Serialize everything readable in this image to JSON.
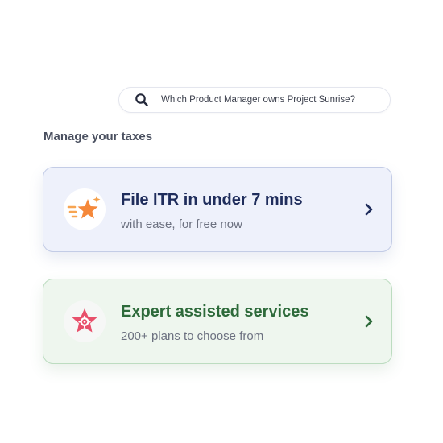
{
  "search": {
    "icon": "search-icon",
    "text": "Which Product Manager owns Project Sunrise?"
  },
  "section": {
    "title": "Manage your taxes"
  },
  "cards": [
    {
      "title": "File ITR in under 7 mins",
      "subtitle": "with ease, for free now",
      "icon": "sparkle-star-icon",
      "accent": "#f5883a",
      "title_color": "#1f2d5c"
    },
    {
      "title": "Expert assisted services",
      "subtitle": "200+ plans to choose from",
      "icon": "badge-star-gear-icon",
      "accent": "#e8506b",
      "title_color": "#2d6a3a"
    }
  ]
}
